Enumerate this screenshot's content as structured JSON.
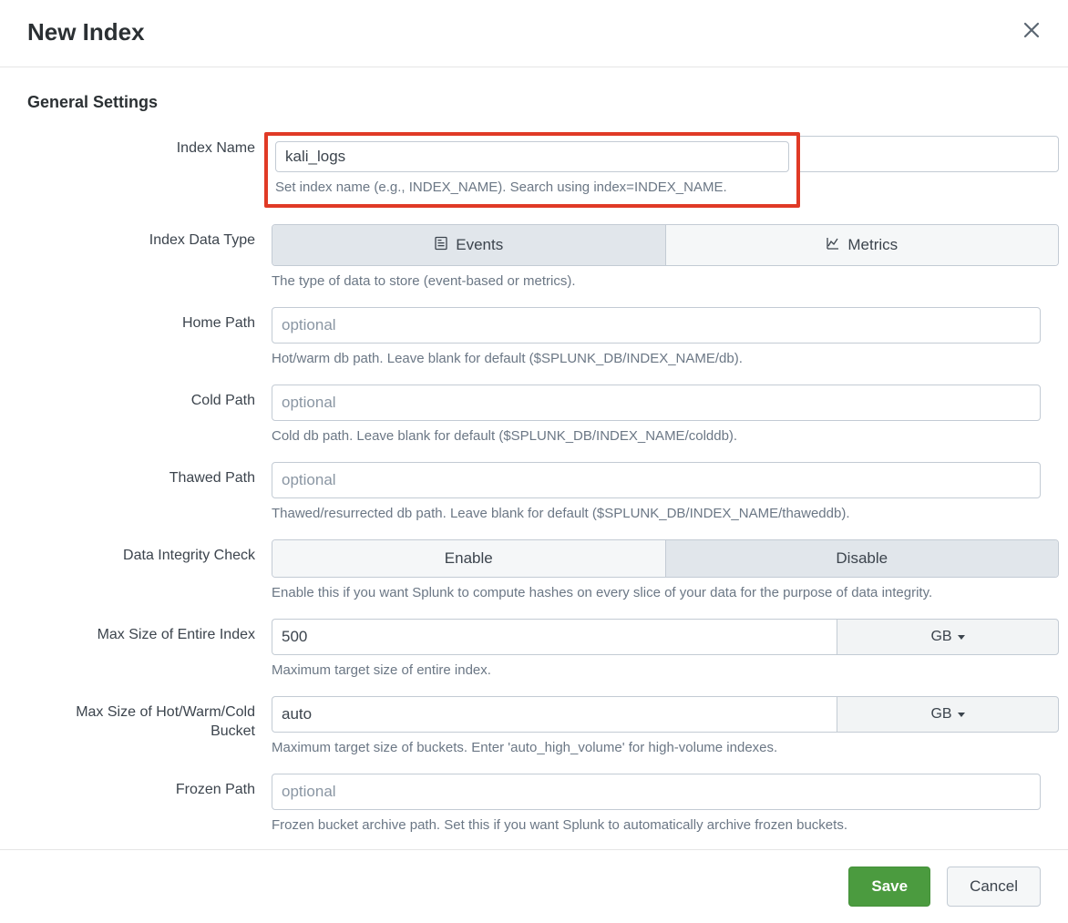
{
  "dialog": {
    "title": "New Index"
  },
  "section": {
    "title": "General Settings"
  },
  "fields": {
    "index_name": {
      "label": "Index Name",
      "value": "kali_logs",
      "hint": "Set index name (e.g., INDEX_NAME). Search using index=INDEX_NAME."
    },
    "data_type": {
      "label": "Index Data Type",
      "option_events": "Events",
      "option_metrics": "Metrics",
      "hint": "The type of data to store (event-based or metrics)."
    },
    "home_path": {
      "label": "Home Path",
      "placeholder": "optional",
      "hint": "Hot/warm db path. Leave blank for default ($SPLUNK_DB/INDEX_NAME/db)."
    },
    "cold_path": {
      "label": "Cold Path",
      "placeholder": "optional",
      "hint": "Cold db path. Leave blank for default ($SPLUNK_DB/INDEX_NAME/colddb)."
    },
    "thawed_path": {
      "label": "Thawed Path",
      "placeholder": "optional",
      "hint": "Thawed/resurrected db path. Leave blank for default ($SPLUNK_DB/INDEX_NAME/thaweddb)."
    },
    "integrity": {
      "label": "Data Integrity Check",
      "option_enable": "Enable",
      "option_disable": "Disable",
      "hint": "Enable this if you want Splunk to compute hashes on every slice of your data for the purpose of data integrity."
    },
    "max_index_size": {
      "label": "Max Size of Entire Index",
      "value": "500",
      "unit": "GB",
      "hint": "Maximum target size of entire index."
    },
    "max_bucket_size": {
      "label": "Max Size of Hot/Warm/Cold Bucket",
      "value": "auto",
      "unit": "GB",
      "hint": "Maximum target size of buckets. Enter 'auto_high_volume' for high-volume indexes."
    },
    "frozen_path": {
      "label": "Frozen Path",
      "placeholder": "optional",
      "hint": "Frozen bucket archive path. Set this if you want Splunk to automatically archive frozen buckets."
    }
  },
  "footer": {
    "save": "Save",
    "cancel": "Cancel"
  }
}
